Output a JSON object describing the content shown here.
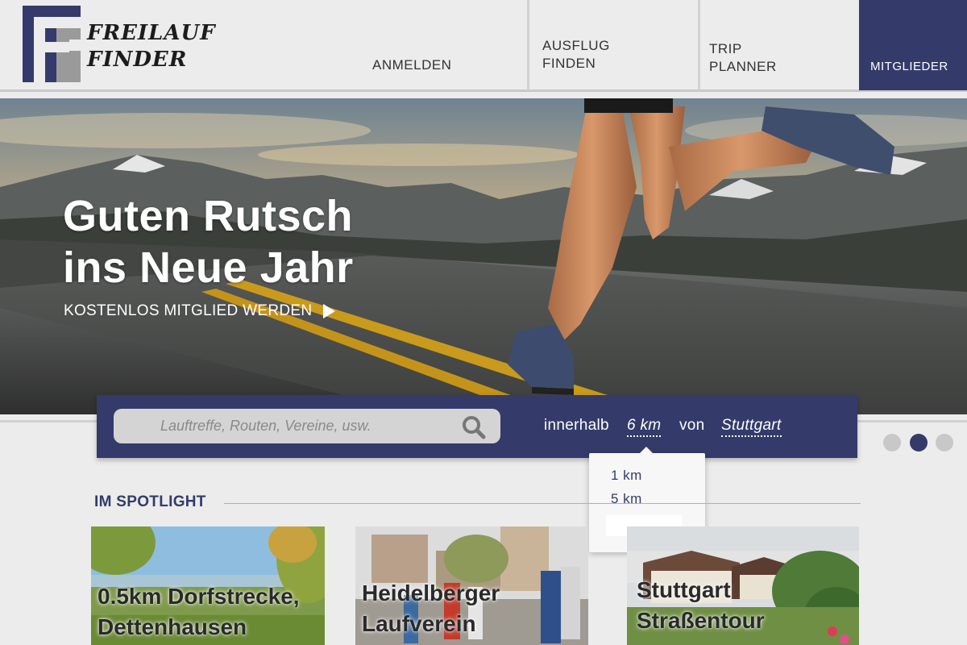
{
  "brand": {
    "logo_line1": "FREILAUF",
    "logo_line2": "FINDER"
  },
  "nav": {
    "anmelden": "ANMELDEN",
    "ausflug_line1": "AUSFLUG",
    "ausflug_line2": "FINDEN",
    "trip_line1": "TRIP",
    "trip_line2": "PLANNER",
    "mitglieder": "MITGLIEDER"
  },
  "hero": {
    "title_line1": "Guten Rutsch",
    "title_line2": "ins Neue Jahr",
    "cta": "KOSTENLOS MITGLIED WERDEN"
  },
  "search": {
    "placeholder": "Lauftreffe, Routen, Vereine, usw.",
    "within_label": "innerhalb",
    "distance_value": "6 km",
    "from_label": "von",
    "city_value": "Stuttgart"
  },
  "distance_dropdown": {
    "options": [
      "1 km",
      "5 km"
    ]
  },
  "carousel": {
    "active_index": 2,
    "count": 3
  },
  "spotlight": {
    "heading": "IM SPOTLIGHT",
    "cards": [
      {
        "line1": "0.5km Dorfstrecke,",
        "line2": "Dettenhausen"
      },
      {
        "line1": "Heidelberger",
        "line2": "Laufverein"
      },
      {
        "line1": "Stuttgart",
        "line2": "Straßentour"
      }
    ]
  },
  "colors": {
    "brand_navy": "#343b6b",
    "background": "#ececec"
  }
}
